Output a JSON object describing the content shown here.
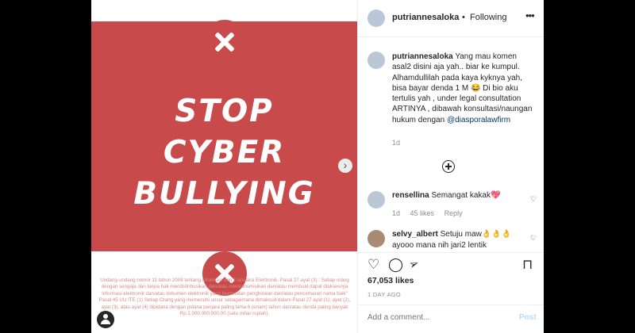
{
  "image": {
    "headline": [
      "STOP",
      "CYBER",
      "BULLYING"
    ],
    "legal_text": "Undang-undang nomor 11 tahun 2008 tentang Informasi dan Transaksi Elektronik. Pasal 27 ayat (3) : Setiap orang dengan sengaja dan tanpa hak mendistribusikan dan/atau mentransmisikan dan/atau membuat dapat diaksesnya Informasi elektronik dan/atau dokumen elektronik yang bermuatan penghinaan dan/atau pencemaran nama baik\" Pasal 45 UU ITE (1) Setiap Orang yang memenuhi unsur sebagaimana dimaksud dalam Pasal 27 ayat (1), ayat (2), ayat (3), atau ayat (4) dipidana dengan pidana penjara paling lama 6 (enam) tahun dan/atau denda paling banyak Rp.1.000.000.000,00 (satu miliar rupiah).",
    "next_arrow": "›"
  },
  "header": {
    "username": "putriannesaloka",
    "separator": "•",
    "follow_state": "Following",
    "more_icon": "•••"
  },
  "caption": {
    "username": "putriannesaloka",
    "text": "Yang mau komen asal2 disini aja yah.. biar ke kumpul. Alhamdullilah pada kaya kyknya yah, bisa bayar denda 1 M 😂 Di bio aku tertulis yah , under legal consultation ARTINYA , dibawah konsultasi/naungan hukum dengan",
    "mention": "@diasporalawfirm",
    "time": "1d"
  },
  "comments": [
    {
      "username": "rensellina",
      "text": "Semangat kakak💖",
      "time": "1d",
      "likes": "45 likes",
      "reply": "Reply"
    },
    {
      "username": "selvy_albert",
      "text": "Setuju maw👌👌👌 ayooo mana nih jari2 lentik"
    }
  ],
  "actions": {
    "likes": "67,053 likes",
    "date": "1 DAY AGO",
    "add_comment_placeholder": "Add a comment...",
    "post_label": "Post"
  },
  "icons": {
    "heart": "♡",
    "comment": "◯",
    "share": "➢",
    "bookmark": "⊓"
  },
  "colors": {
    "panel_red": "#c94a4b",
    "link_blue": "#00376b",
    "post_disabled": "#b2dffc"
  }
}
